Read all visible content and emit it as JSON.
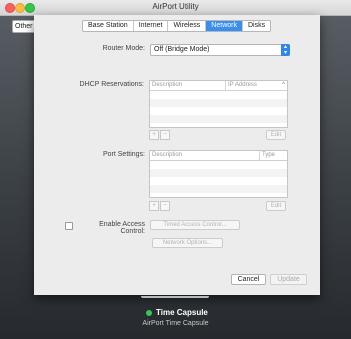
{
  "window": {
    "title": "AirPort Utility"
  },
  "background": {
    "other_button": "Other"
  },
  "tabs": [
    {
      "label": "Base Station",
      "selected": false
    },
    {
      "label": "Internet",
      "selected": false
    },
    {
      "label": "Wireless",
      "selected": false
    },
    {
      "label": "Network",
      "selected": true
    },
    {
      "label": "Disks",
      "selected": false
    }
  ],
  "router_mode": {
    "label": "Router Mode:",
    "value": "Off (Bridge Mode)"
  },
  "dhcp": {
    "label": "DHCP Reservations:",
    "columns": [
      "Description",
      "IP Address"
    ],
    "add_label": "+",
    "remove_label": "−",
    "edit_label": "Edit"
  },
  "port_settings": {
    "label": "Port Settings:",
    "columns": [
      "Description",
      "Type"
    ],
    "add_label": "+",
    "remove_label": "−",
    "edit_label": "Edit"
  },
  "access_control": {
    "checkbox_label": "Enable Access Control:",
    "checked": false,
    "timed_button": "Timed Access Control..."
  },
  "network_options_button": "Network Options...",
  "footer": {
    "cancel": "Cancel",
    "update": "Update"
  },
  "device": {
    "name": "Time Capsule",
    "type": "AirPort Time Capsule",
    "status_color": "#35c759"
  },
  "colors": {
    "accent": "#3a8ef0"
  }
}
